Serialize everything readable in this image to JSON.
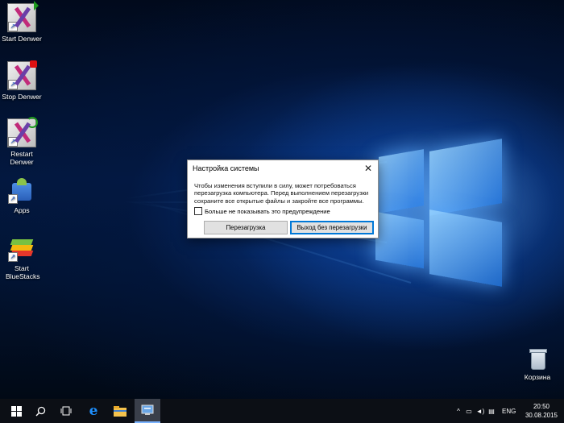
{
  "desktop": {
    "icons": [
      {
        "label": "Start Denwer",
        "icon": "denwer-start-icon"
      },
      {
        "label": "Stop Denwer",
        "icon": "denwer-stop-icon"
      },
      {
        "label": "Restart Denwer",
        "icon": "denwer-restart-icon"
      },
      {
        "label": "Apps",
        "icon": "android-apps-icon"
      },
      {
        "label": "Start BlueStacks",
        "icon": "bluestacks-icon"
      }
    ],
    "recycle_bin": {
      "label": "Корзина",
      "icon": "recycle-bin-icon"
    }
  },
  "dialog": {
    "title": "Настройка системы",
    "message": "Чтобы изменения вступили в силу, может потребоваться перезагрузка компьютера. Перед выполнением перезагрузки сохраните все открытые файлы и закройте все программы.",
    "checkbox_label": "Больше не показывать это предупреждение",
    "checkbox_checked": false,
    "restart_button": "Перезагрузка",
    "exit_button": "Выход без перезагрузки"
  },
  "taskbar": {
    "icons": [
      "windows-start-icon",
      "search-icon",
      "task-view-icon",
      "edge-icon",
      "file-explorer-icon",
      "system-config-icon"
    ],
    "tray": {
      "language": "ENG",
      "time": "20:50",
      "date": "30.08.2015",
      "icons": [
        "chevron-up-icon",
        "network-icon",
        "volume-icon",
        "notifications-icon"
      ]
    }
  },
  "colors": {
    "accent": "#0078d7",
    "taskbar": "#0c0f15"
  }
}
